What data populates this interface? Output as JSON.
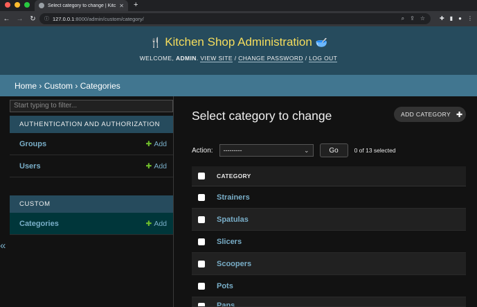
{
  "browser": {
    "tab_title": "Select category to change | Kitc",
    "url_host": "127.0.0.1",
    "url_rest": ":8000/admin/custom/category/",
    "colors": {
      "close": "#ff5f57",
      "minimize": "#febc2e",
      "zoom": "#28c840"
    }
  },
  "header": {
    "site_name": "Kitchen Shop Administration",
    "welcome": "Welcome,",
    "user": "admin",
    "view_site": "View site",
    "change_password": "Change password",
    "log_out": "Log out",
    "sep1": "/",
    "sep2": "/"
  },
  "breadcrumbs": {
    "home": "Home",
    "app": "Custom",
    "current": "Categories",
    "sep": "›"
  },
  "sidebar": {
    "filter_placeholder": "Start typing to filter...",
    "collapse_label": "«",
    "modules": [
      {
        "title": "Authentication and Authorization",
        "models": [
          {
            "name": "Groups",
            "add": "Add"
          },
          {
            "name": "Users",
            "add": "Add"
          }
        ]
      },
      {
        "title": "Custom",
        "models": [
          {
            "name": "Categories",
            "add": "Add"
          }
        ]
      }
    ]
  },
  "main": {
    "title": "Select category to change",
    "add_button": "Add category",
    "action_label": "Action:",
    "action_selected": "---------",
    "go_label": "Go",
    "counter": "0 of 13 selected",
    "column_header": "Category",
    "rows": [
      "Strainers",
      "Spatulas",
      "Slicers",
      "Scoopers",
      "Pots",
      "Pans"
    ]
  }
}
